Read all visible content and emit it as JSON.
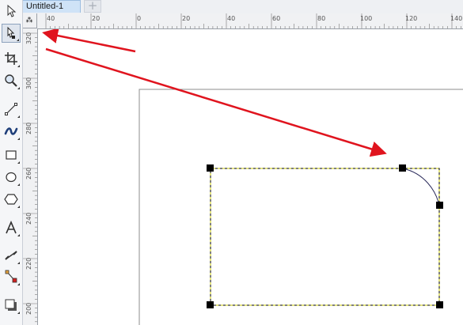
{
  "document_tab": {
    "title": "Untitled-1",
    "add_label": "+"
  },
  "ruler_corner_glyph": "⁂",
  "horizontal_ruler": {
    "labels": [
      "40",
      "20",
      "0",
      "20",
      "40",
      "60",
      "80",
      "100",
      "120",
      "140"
    ]
  },
  "vertical_ruler": {
    "labels": [
      "320",
      "300",
      "280",
      "260",
      "240",
      "220",
      "200"
    ]
  },
  "toolbox": [
    "pick-tool",
    "shape-tool",
    "crop-tool",
    "zoom-tool",
    "freehand-tool",
    "artistic-media-tool",
    "rectangle-tool",
    "ellipse-tool",
    "polygon-tool",
    "text-tool",
    "dimension-tool",
    "interactive-fill-tool",
    "shadow-tool"
  ],
  "colors": {
    "arrow": "#e0141e",
    "marquee": "#c8c800",
    "node": "#000000",
    "curve": "#2a2a5a",
    "page_border": "#8c8c8c"
  }
}
